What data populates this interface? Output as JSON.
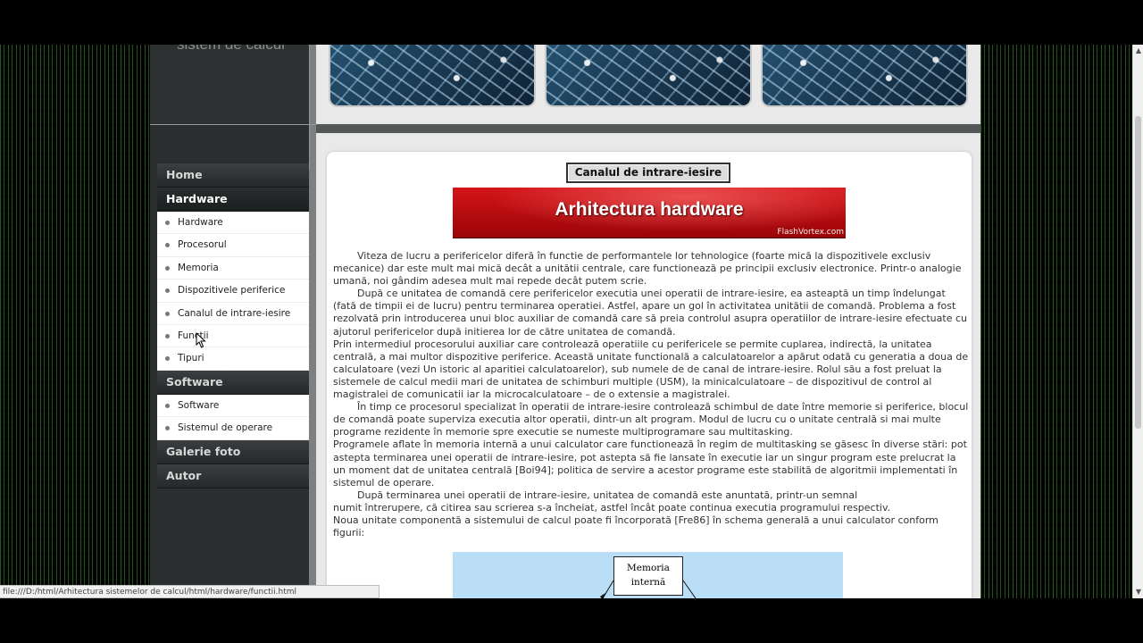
{
  "sidebar": {
    "subtitle": "sistem de calcul",
    "menu": [
      {
        "label": "Home"
      },
      {
        "label": "Hardware",
        "items": [
          "Hardware",
          "Procesorul",
          "Memoria",
          "Dispozitivele periferice",
          "Canalul de intrare-iesire",
          "Functii",
          "Tipuri"
        ]
      },
      {
        "label": "Software",
        "items": [
          "Software",
          "Sistemul de operare"
        ]
      },
      {
        "label": "Galerie foto"
      },
      {
        "label": "Autor"
      }
    ]
  },
  "content": {
    "title": "Canalul de intrare-iesire",
    "banner": {
      "title": "Arhitectura hardware",
      "credit": "FlashVortex.com"
    },
    "paragraphs": [
      "Viteza de lucru a perifericelor diferă în functie de performantele lor tehnologice (foarte mică la dispozitivele exclusiv mecanice) dar este mult mai mică decât a unitătii centrale, care functionează pe principii exclusiv electronice. Printr-o analogie umană, noi gândim adesea mult mai repede decât putem scrie.",
      "După ce unitatea de comandă cere perifericelor executia unei operatii de intrare-iesire, ea asteaptă un timp îndelungat (fată de timpii ei de lucru) pentru terminarea operatiei. Astfel, apare un gol în activitatea unitătii de comandă. Problema a fost rezolvată prin introducerea unui bloc auxiliar de comandă care să preia controlul asupra operatiilor de intrare-iesire efectuate cu ajutorul perifericelor după initierea lor de către unitatea de comandă.",
      "Prin intermediul procesorului auxiliar care controlează operatiile cu perifericele se permite cuplarea, indirectă, la unitatea centrală, a mai multor dispozitive periferice. Această unitate functională a calculatoarelor a apărut odată cu generatia a doua de calculatoare (vezi Un istoric al aparitiei calculatoarelor), sub numele de de canal de intrare-iesire. Rolul său a fost preluat la sistemele de calcul medii mari de unitatea de schimburi multiple (USM), la minicalculatoare – de dispozitivul de control al magistralei de comunicatii iar la microcalculatoare – de o extensie a magistralei.",
      "În timp ce procesorul specializat în operatii de intrare-iesire controlează schimbul de date între memorie si periferice, blocul de comandă poate superviza executia altor operatii, dintr-un alt program. Modul de lucru cu o unitate centrală si mai multe programe rezidente în memorie spre executie se numeste multiprogramare sau multitasking.",
      "Programele aflate în memoria internă a unui calculator care functionează în regim de multitasking se găsesc în diverse stări: pot astepta terminarea unei operatii de intrare-iesire, pot astepta să fie lansate în executie iar un singur program este prelucrat la un moment dat de unitatea centrală [Boi94]; politica de servire a acestor programe este stabilită de algoritmii implementati în sistemul de operare.",
      "După terminarea unei operatii de intrare-iesire, unitatea de comandă este anuntată, printr-un semnal",
      "numit întrerupere, că citirea sau scrierea s-a încheiat, astfel încât poate continua executia programului respectiv.",
      "Noua unitate componentă a sistemului de calcul poate fi încorporată [Fre86] în schema generală a unui calculator conform figurii:"
    ],
    "diagram_node": "Memoria internă"
  },
  "status_bar": "file:///D:/html/Arhitectura sistemelor de calcul/html/hardware/functii.html"
}
